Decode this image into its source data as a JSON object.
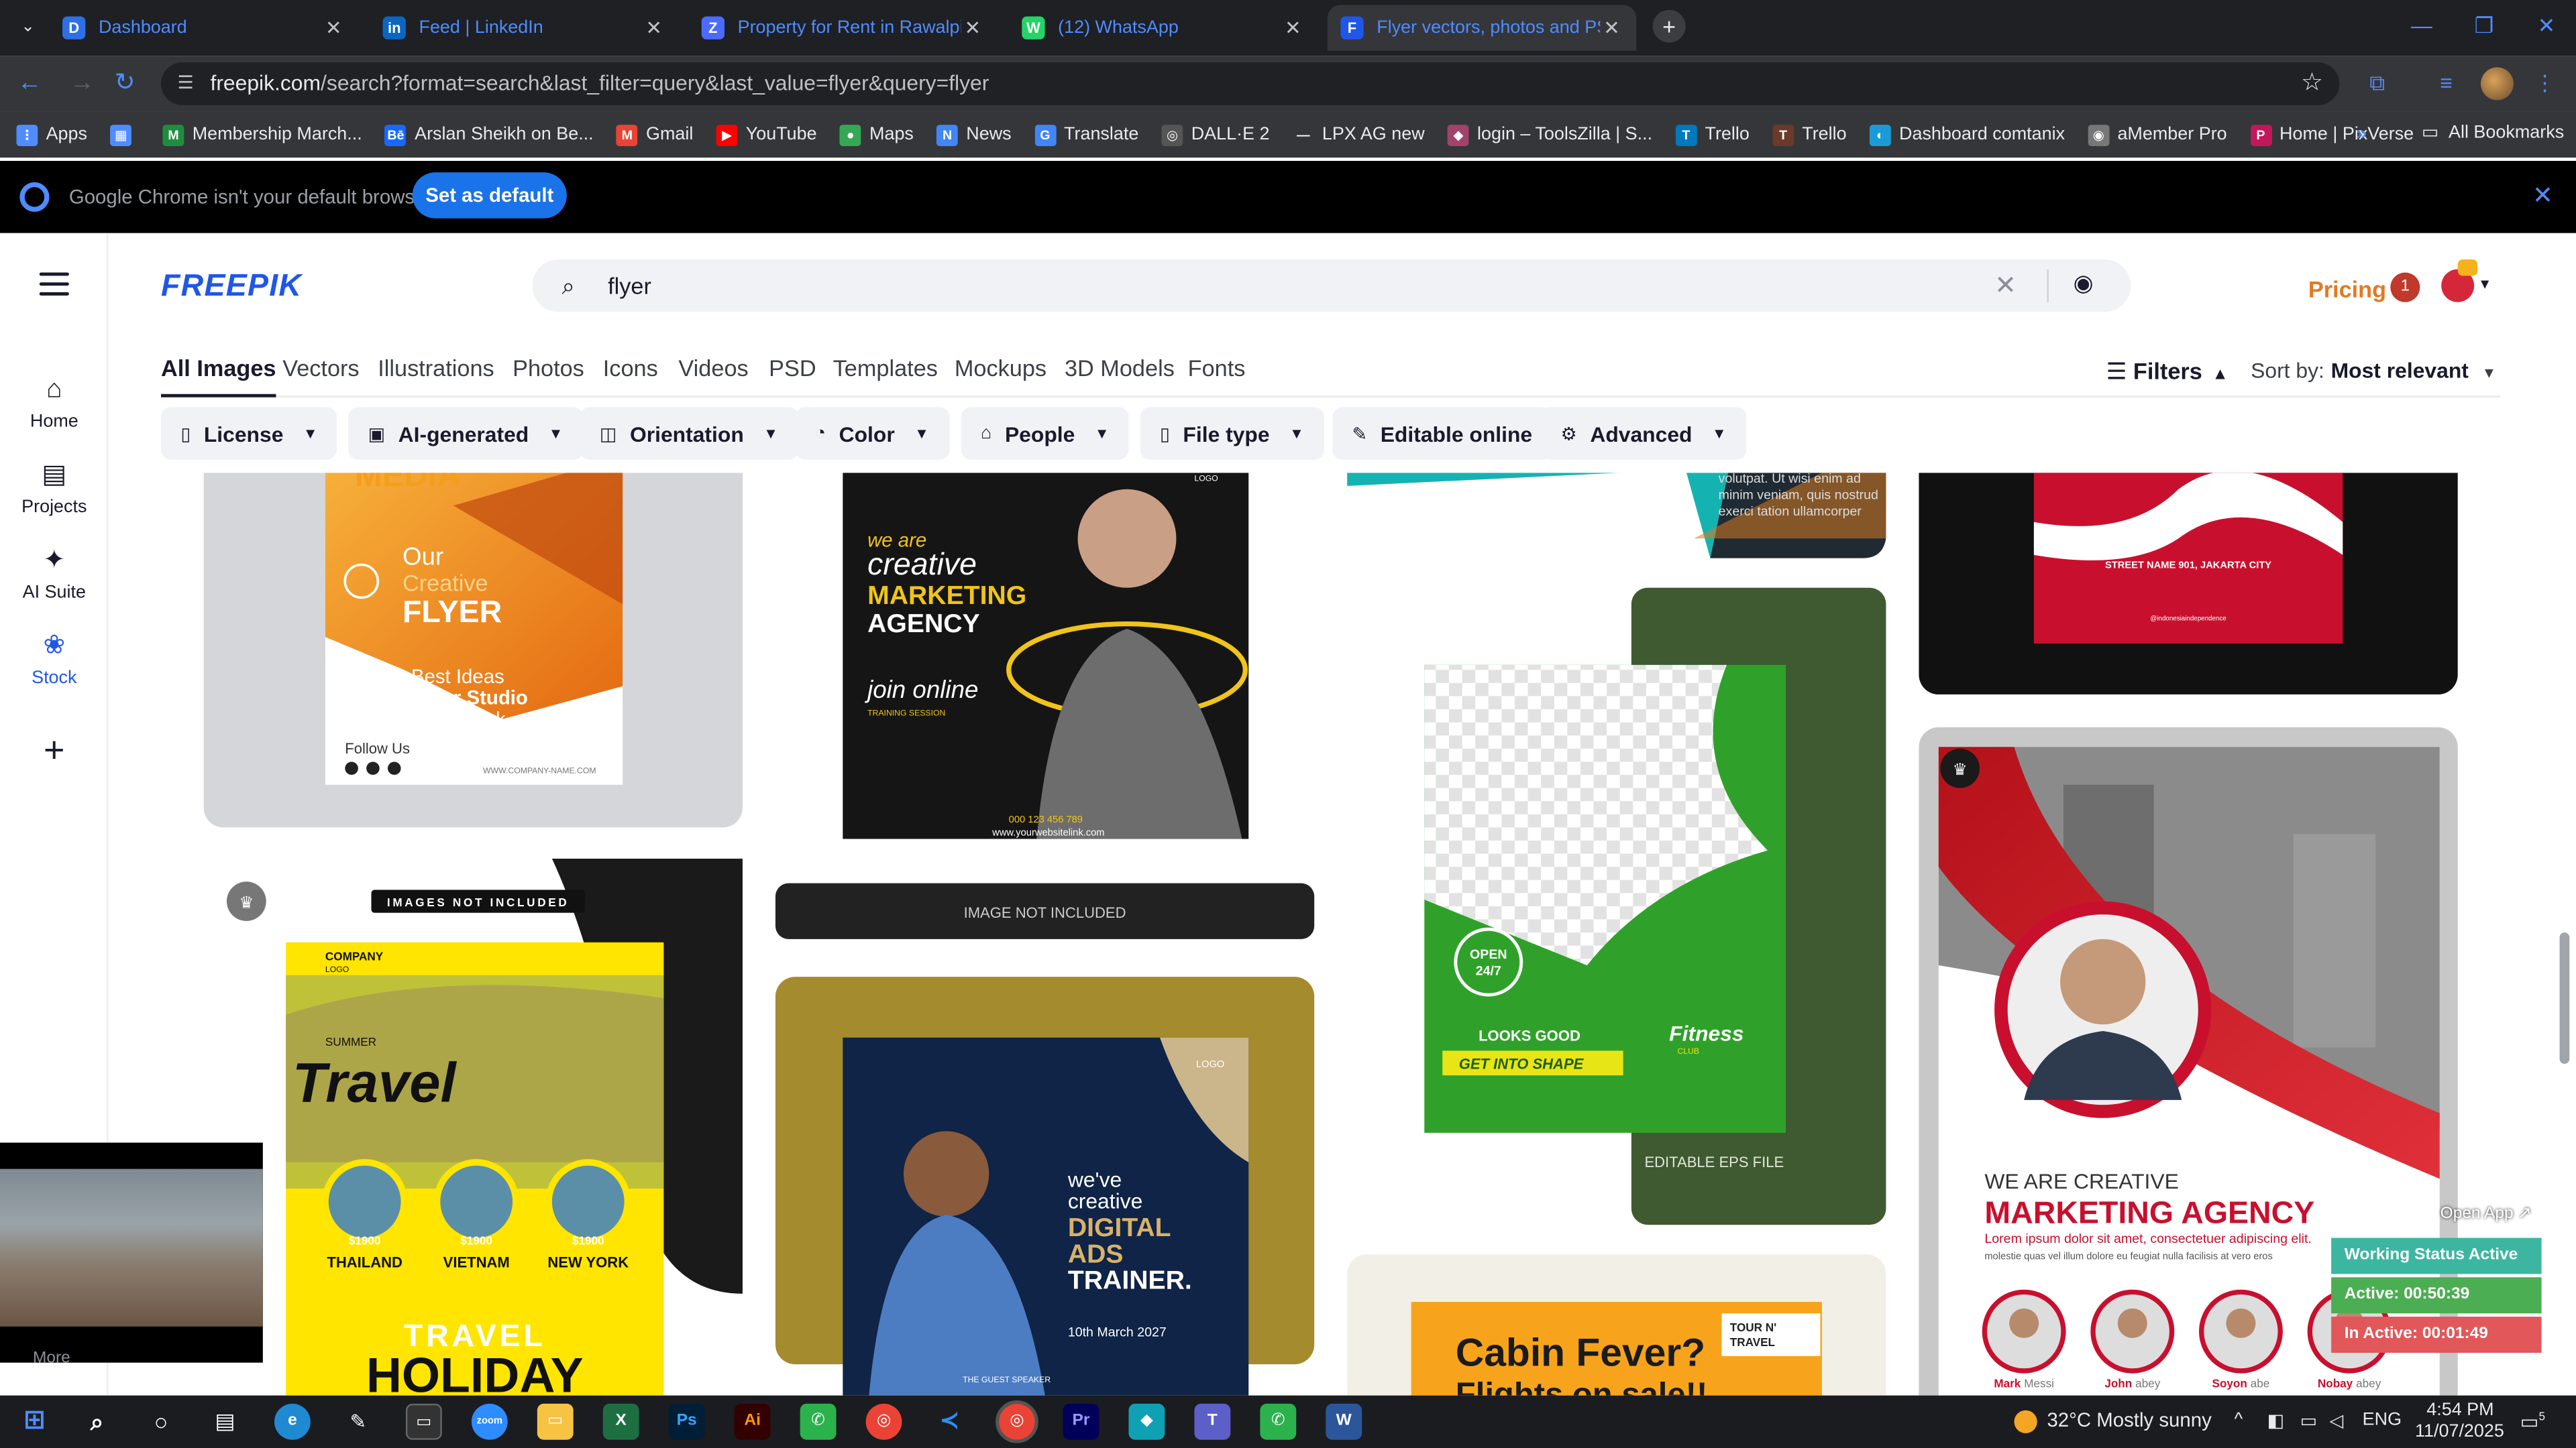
{
  "browser": {
    "tabs": [
      {
        "title": "Dashboard",
        "color": "#2f6fe4",
        "icon": "D",
        "active": false
      },
      {
        "title": "Feed | LinkedIn",
        "color": "#0a66c2",
        "icon": "in",
        "active": false
      },
      {
        "title": "Property for Rent in Rawalpindi",
        "color": "#4b6bff",
        "icon": "Z",
        "active": false
      },
      {
        "title": "(12) WhatsApp",
        "color": "#25d366",
        "icon": "W",
        "active": false
      },
      {
        "title": "Flyer vectors, photos and PSD fi",
        "color": "#2057e8",
        "icon": "F",
        "active": true
      }
    ],
    "url_domain": "freepik.com",
    "url_path": "/search?format=search&last_filter=query&last_value=flyer&query=flyer",
    "bookmarks": [
      {
        "label": "Apps",
        "color": "#4f8cff",
        "icon": "⋮"
      },
      {
        "label": "",
        "color": "#4f8cff",
        "icon": "▦"
      },
      {
        "label": "Membership March...",
        "color": "#1e8e3e",
        "icon": "M"
      },
      {
        "label": "Arslan Sheikh on Be...",
        "color": "#1769ff",
        "icon": "Bē"
      },
      {
        "label": "Gmail",
        "color": "#ea4335",
        "icon": "M"
      },
      {
        "label": "YouTube",
        "color": "#ff0000",
        "icon": "▶"
      },
      {
        "label": "Maps",
        "color": "#34a853",
        "icon": "●"
      },
      {
        "label": "News",
        "color": "#4285f4",
        "icon": "N"
      },
      {
        "label": "Translate",
        "color": "#4285f4",
        "icon": "G"
      },
      {
        "label": "DALL·E 2",
        "color": "#555",
        "icon": "◎"
      },
      {
        "label": "LPX AG new",
        "color": "#35363a",
        "icon": "—"
      },
      {
        "label": "login – ToolsZilla | S...",
        "color": "#a1436b",
        "icon": "◆"
      },
      {
        "label": "Trello",
        "color": "#0079bf",
        "icon": "T"
      },
      {
        "label": "Trello",
        "color": "#6b3a2a",
        "icon": "T"
      },
      {
        "label": "Dashboard comtanix",
        "color": "#1a9bd7",
        "icon": "◐"
      },
      {
        "label": "aMember Pro",
        "color": "#777",
        "icon": "◉"
      },
      {
        "label": "Home | PixVerse",
        "color": "#c2185b",
        "icon": "P"
      }
    ],
    "bookmarks_more": "»",
    "all_bookmarks": "All Bookmarks",
    "infobar_message": "Google Chrome isn't your default browser",
    "set_default_label": "Set as default"
  },
  "sidebar": {
    "items": [
      {
        "label": "Home",
        "icon": "⌂"
      },
      {
        "label": "Projects",
        "icon": "▤"
      },
      {
        "label": "AI Suite",
        "icon": "✦"
      },
      {
        "label": "Stock",
        "icon": "❀"
      }
    ],
    "add_icon": "+",
    "more_label": "More"
  },
  "header": {
    "logo": "FREEPIK",
    "search_value": "flyer",
    "pricing": "Pricing",
    "notif_count": "1"
  },
  "category_tabs": [
    "All Images",
    "Vectors",
    "Illustrations",
    "Photos",
    "Icons",
    "Videos",
    "PSD",
    "Templates",
    "Mockups",
    "3D Models",
    "Fonts"
  ],
  "filters_label": "Filters",
  "sort_label": "Sort by:",
  "sort_value": "Most relevant",
  "filter_chips": [
    {
      "label": "License",
      "icon": "▯"
    },
    {
      "label": "AI-generated",
      "icon": "▣"
    },
    {
      "label": "Orientation",
      "icon": "◫"
    },
    {
      "label": "Color",
      "icon": "◔"
    },
    {
      "label": "People",
      "icon": "⌂"
    },
    {
      "label": "File type",
      "icon": "▯"
    },
    {
      "label": "Editable online",
      "icon": "✎"
    },
    {
      "label": "Advanced",
      "icon": "⚙"
    }
  ],
  "cards": {
    "media_title": "MEDIA",
    "creative_flyer": {
      "line1": "Our",
      "line2": "Creative",
      "line3": "FLYER",
      "sub1": "It's Best Ideas",
      "sub2": "For Ever Studio",
      "sub3": "Creative Work",
      "follow": "Follow Us",
      "site": "WWW.COMPANY-NAME.COM"
    },
    "marketing_agency": {
      "line1": "we are",
      "line2": "creative",
      "line3": "MARKETING",
      "line4": "AGENCY",
      "line5": "join online",
      "line6": "TRAINING SESSION",
      "phone": "000 123 456 789",
      "site": "www.yourwebsitelink.com",
      "logo": "LOGO"
    },
    "image_not_included": "IMAGE NOT INCLUDED",
    "travel": {
      "banner": "IMAGES NOT INCLUDED",
      "company": "COMPANY",
      "company_sub": "LOGO",
      "summer": "SUMMER",
      "title": "Travel",
      "dest": [
        {
          "price": "$1900",
          "name": "THAILAND"
        },
        {
          "price": "$1900",
          "name": "VIETNAM"
        },
        {
          "price": "$1900",
          "name": "NEW YORK"
        }
      ],
      "footer1": "TRAVEL",
      "footer2": "HOLIDAY"
    },
    "digital_ads": {
      "logo": "LOGO",
      "line1": "we've",
      "line2": "creative",
      "line3": "DIGITAL",
      "line4": "ADS",
      "line5": "TRAINER.",
      "date": "10th March 2027",
      "speaker": "THE GUEST SPEAKER"
    },
    "fitness": {
      "open1": "OPEN",
      "open2": "24/7",
      "looks": "LOOKS GOOD",
      "shape": "GET INTO SHAPE",
      "brand": "Fitness",
      "club": "CLUB",
      "editable": "EDITABLE EPS FILE"
    },
    "jakarta": {
      "address": "STREET NAME 901, JAKARTA CITY",
      "tag": "@indonesiaindependence"
    },
    "teal_text": {
      "l1": "volutpat. Ut wisi enim ad",
      "l2": "minim veniam, quis nostrud",
      "l3": "exerci tation ullamcorper"
    },
    "red_agency": {
      "we_are": "WE ARE CREATIVE",
      "title": "MARKETING AGENCY",
      "lorem": "Lorem ipsum dolor sit amet, consectetuer adipiscing elit.",
      "lorem2": "molestie quas vel illum dolore eu feugiat nulla facilisis at vero eros",
      "people": [
        {
          "first": "Mark",
          "last": "Messi"
        },
        {
          "first": "John",
          "last": "abey"
        },
        {
          "first": "Soyon",
          "last": "abe"
        },
        {
          "first": "Nobay",
          "last": "abey"
        }
      ]
    },
    "cabin": {
      "title": "Cabin Fever?",
      "sub": "Flights on sale!!",
      "brand1": "TOUR N'",
      "brand2": "TRAVEL"
    }
  },
  "status_widget": {
    "open_app": "Open App ↗",
    "working": "Working Status Active",
    "active": "Active: 00:50:39",
    "inactive": "In Active: 00:01:49"
  },
  "taskbar": {
    "weather": "32°C  Mostly sunny",
    "lang": "ENG",
    "time": "4:54 PM",
    "date": "11/07/2025",
    "notif": "5"
  }
}
